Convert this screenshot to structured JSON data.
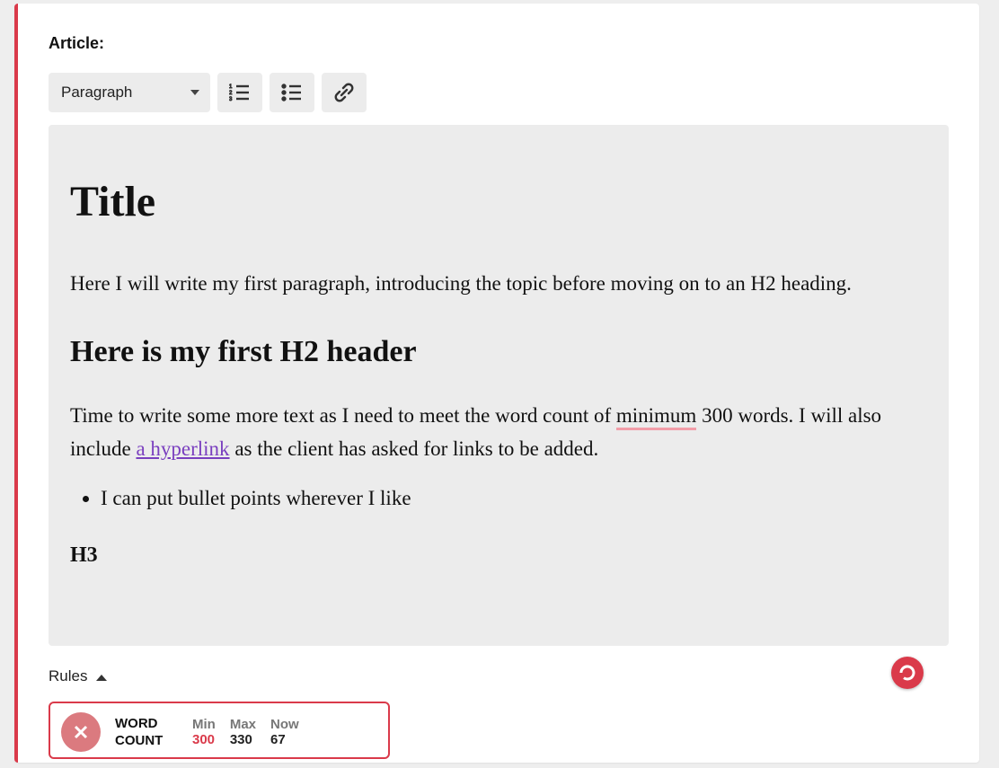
{
  "label": "Article:",
  "toolbar": {
    "block_type": "Paragraph"
  },
  "article": {
    "title": "Title",
    "p1": "Here I will write my first paragraph, introducing the topic before moving on to an H2 heading.",
    "h2": "Here is my first H2 header",
    "p2_a": "Time to write some more text as I need to meet the word count of ",
    "p2_spell": "minimum",
    "p2_b": " 300 words. I will also include ",
    "p2_link": "a hyperlink",
    "p2_c": " as the client has asked for links to be added.",
    "bullet1": "I can put bullet points wherever I like",
    "h3": "H3"
  },
  "rules": {
    "header": "Rules",
    "word_count": {
      "title1": "WORD",
      "title2": "COUNT",
      "min_label": "Min",
      "max_label": "Max",
      "now_label": "Now",
      "min": "300",
      "max": "330",
      "now": "67"
    }
  }
}
